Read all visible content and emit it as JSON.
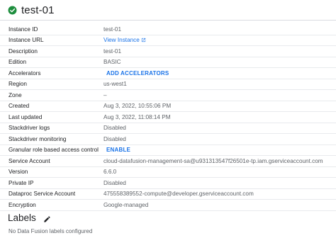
{
  "instance": {
    "name": "test-01",
    "status_icon": "check-circle-icon",
    "status_color": "#1e8e3e"
  },
  "details": [
    {
      "key": "instance_id",
      "label": "Instance ID",
      "value": "test-01",
      "type": "text"
    },
    {
      "key": "instance_url",
      "label": "Instance URL",
      "value": "View Instance",
      "type": "link"
    },
    {
      "key": "description",
      "label": "Description",
      "value": "test-01",
      "type": "text"
    },
    {
      "key": "edition",
      "label": "Edition",
      "value": "BASIC",
      "type": "text"
    },
    {
      "key": "accelerators",
      "label": "Accelerators",
      "value": "ADD ACCELERATORS",
      "type": "button"
    },
    {
      "key": "region",
      "label": "Region",
      "value": "us-west1",
      "type": "text"
    },
    {
      "key": "zone",
      "label": "Zone",
      "value": "–",
      "type": "text"
    },
    {
      "key": "created",
      "label": "Created",
      "value": "Aug 3, 2022, 10:55:06 PM",
      "type": "text"
    },
    {
      "key": "last_updated",
      "label": "Last updated",
      "value": "Aug 3, 2022, 11:08:14 PM",
      "type": "text"
    },
    {
      "key": "stackdriver_logs",
      "label": "Stackdriver logs",
      "value": "Disabled",
      "type": "text"
    },
    {
      "key": "stackdriver_monitoring",
      "label": "Stackdriver monitoring",
      "value": "Disabled",
      "type": "text"
    },
    {
      "key": "rbac",
      "label": "Granular role based access control",
      "value": "ENABLE",
      "type": "button"
    },
    {
      "key": "service_account",
      "label": "Service Account",
      "value": "cloud-datafusion-management-sa@u931313547f26501e-tp.iam.gserviceaccount.com",
      "type": "text"
    },
    {
      "key": "version",
      "label": "Version",
      "value": "6.6.0",
      "type": "text"
    },
    {
      "key": "private_ip",
      "label": "Private IP",
      "value": "Disabled",
      "type": "text"
    },
    {
      "key": "dataproc_sa",
      "label": "Dataproc Service Account",
      "value": "475558389552-compute@developer.gserviceaccount.com",
      "type": "text"
    },
    {
      "key": "encryption",
      "label": "Encryption",
      "value": "Google-managed",
      "type": "text"
    }
  ],
  "labels": {
    "heading": "Labels",
    "edit_icon": "pencil-icon",
    "empty_text": "No Data Fusion labels configured"
  },
  "colors": {
    "link": "#1a73e8",
    "divider": "#e8eaed"
  }
}
